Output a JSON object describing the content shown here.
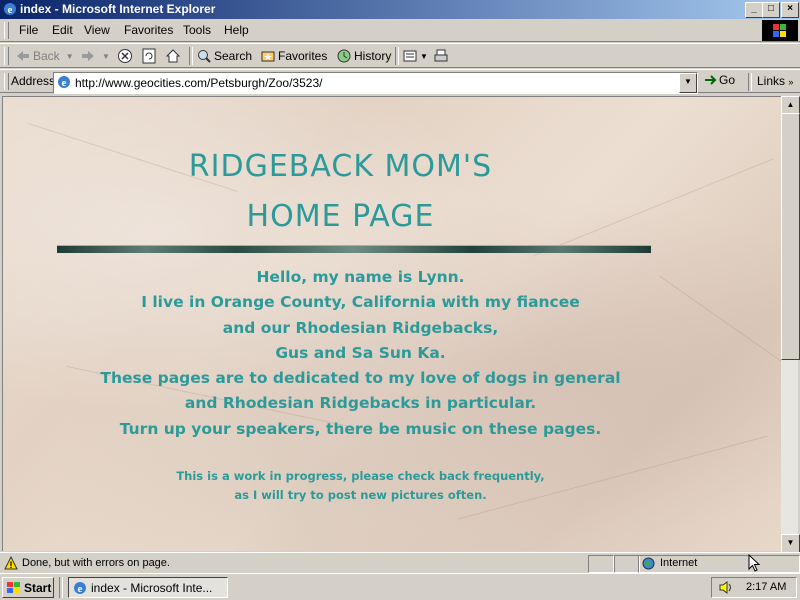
{
  "window": {
    "title": "index - Microsoft Internet Explorer",
    "controls": {
      "minimize": "_",
      "maximize": "□",
      "close": "×"
    }
  },
  "menu": [
    "File",
    "Edit",
    "View",
    "Favorites",
    "Tools",
    "Help"
  ],
  "toolbar": {
    "back": "Back",
    "search": "Search",
    "favorites": "Favorites",
    "history": "History"
  },
  "address": {
    "label": "Address",
    "url": "http://www.geocities.com/Petsburgh/Zoo/3523/",
    "go": "Go",
    "links": "Links"
  },
  "page": {
    "title_lines": [
      "RIDGEBACK MOM'S",
      "HOME PAGE"
    ],
    "intro_lines": [
      "Hello, my name is Lynn.",
      "I live in Orange County, California with my fiancee",
      "and our Rhodesian Ridgebacks,",
      "Gus and Sa Sun Ka.",
      "These pages are to dedicated to my love of dogs in general",
      "and Rhodesian Ridgebacks in particular.",
      "Turn up your speakers, there be music on these pages."
    ],
    "notice_lines": [
      "This is a work in progress, please check back frequently,",
      "as I will try to post new pictures often."
    ],
    "text_color": "#2d9a9a"
  },
  "status": {
    "message": "Done, but with errors on page.",
    "zone": "Internet"
  },
  "taskbar": {
    "start": "Start",
    "task": "index - Microsoft Inte...",
    "clock": "2:17 AM"
  },
  "colors": {
    "titlebar": "#0a246a",
    "chrome": "#d4d0c8"
  }
}
